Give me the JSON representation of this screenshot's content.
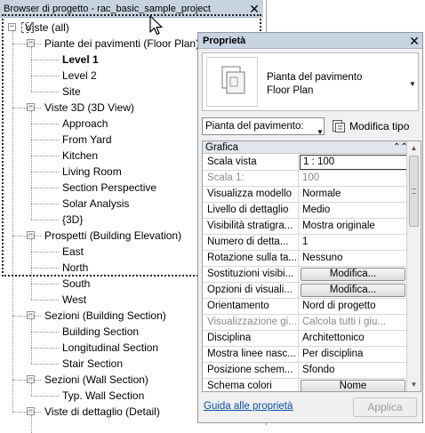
{
  "browser": {
    "title": "Browser di progetto - rac_basic_sample_project",
    "close_glyph": "✕",
    "tree": [
      {
        "label": "Viste (all)",
        "level": 0,
        "toggle": "−"
      },
      {
        "label": "Piante dei pavimenti (Floor Plan)",
        "level": 1,
        "toggle": "−"
      },
      {
        "label": "Level 1",
        "level": 2,
        "bold": true
      },
      {
        "label": "Level 2",
        "level": 2
      },
      {
        "label": "Site",
        "level": 2
      },
      {
        "label": "Viste 3D (3D View)",
        "level": 1,
        "toggle": "−"
      },
      {
        "label": "Approach",
        "level": 2
      },
      {
        "label": "From Yard",
        "level": 2
      },
      {
        "label": "Kitchen",
        "level": 2
      },
      {
        "label": "Living Room",
        "level": 2
      },
      {
        "label": "Section Perspective",
        "level": 2
      },
      {
        "label": "Solar Analysis",
        "level": 2
      },
      {
        "label": "{3D}",
        "level": 2
      },
      {
        "label": "Prospetti (Building Elevation)",
        "level": 1,
        "toggle": "−"
      },
      {
        "label": "East",
        "level": 2
      },
      {
        "label": "North",
        "level": 2
      },
      {
        "label": "South",
        "level": 2
      },
      {
        "label": "West",
        "level": 2
      },
      {
        "label": "Sezioni (Building Section)",
        "level": 1,
        "toggle": "−"
      },
      {
        "label": "Building Section",
        "level": 2
      },
      {
        "label": "Longitudinal Section",
        "level": 2
      },
      {
        "label": "Stair Section",
        "level": 2
      },
      {
        "label": "Sezioni (Wall Section)",
        "level": 1,
        "toggle": "−"
      },
      {
        "label": "Typ. Wall Section",
        "level": 2
      },
      {
        "label": "Viste di dettaglio (Detail)",
        "level": 1,
        "toggle": "−"
      }
    ]
  },
  "properties": {
    "title": "Proprietà",
    "close_glyph": "✕",
    "type_name_line1": "Pianta del pavimento",
    "type_name_line2": "Floor Plan",
    "instance_filter": "Pianta del pavimento:",
    "edit_type_label": "Modifica tipo",
    "group_header": "Grafica",
    "rows": [
      {
        "name": "Scala vista",
        "value": "1 : 100",
        "kind": "edit"
      },
      {
        "name": "Scala 1:",
        "value": "100",
        "kind": "disabled"
      },
      {
        "name": "Visualizza modello",
        "value": "Normale",
        "kind": "text"
      },
      {
        "name": "Livello di dettaglio",
        "value": "Medio",
        "kind": "text"
      },
      {
        "name": "Visibilità stratigra...",
        "value": "Mostra originale",
        "kind": "text"
      },
      {
        "name": "Numero di detta...",
        "value": "1",
        "kind": "text"
      },
      {
        "name": "Rotazione sulla ta...",
        "value": "Nessuno",
        "kind": "text"
      },
      {
        "name": "Sostituzioni visibi...",
        "value": "Modifica...",
        "kind": "button"
      },
      {
        "name": "Opzioni di visuali...",
        "value": "Modifica...",
        "kind": "button"
      },
      {
        "name": "Orientamento",
        "value": "Nord di progetto",
        "kind": "text"
      },
      {
        "name": "Visualizzazione gi...",
        "value": "Calcola tutti i giu...",
        "kind": "disabled"
      },
      {
        "name": "Disciplina",
        "value": "Architettonico",
        "kind": "text"
      },
      {
        "name": "Mostra linee nasc...",
        "value": "Per disciplina",
        "kind": "text"
      },
      {
        "name": "Posizione schem...",
        "value": "Sfondo",
        "kind": "text"
      },
      {
        "name": "Schema colori",
        "value": "Nome",
        "kind": "button"
      }
    ],
    "help_link": "Guida alle proprietà",
    "apply_label": "Applica"
  }
}
